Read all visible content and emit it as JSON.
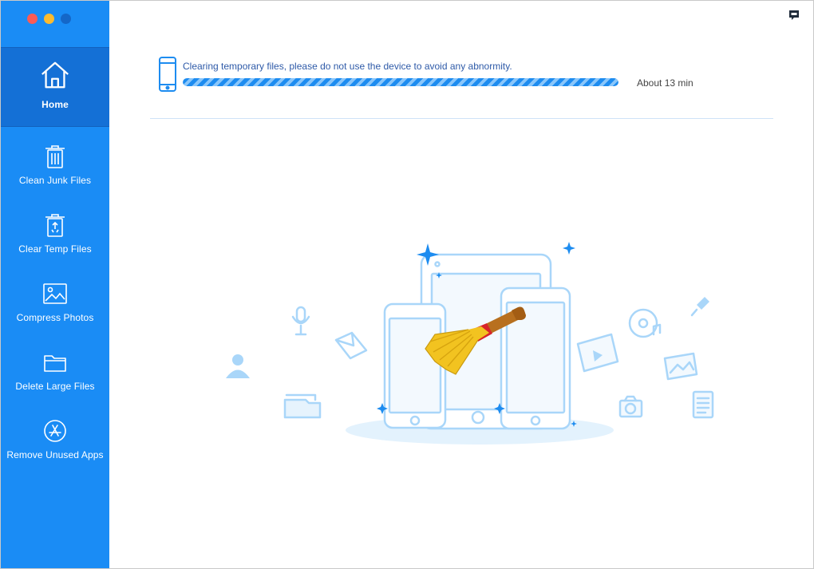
{
  "window": {
    "controls": [
      "close",
      "minimize",
      "zoom"
    ]
  },
  "sidebar": {
    "items": [
      {
        "label": "Home",
        "icon": "home-icon",
        "active": true
      },
      {
        "label": "Clean Junk Files",
        "icon": "trash-icon",
        "active": false
      },
      {
        "label": "Clear Temp Files",
        "icon": "temp-trash-icon",
        "active": false
      },
      {
        "label": "Compress Photos",
        "icon": "photo-icon",
        "active": false
      },
      {
        "label": "Delete Large Files",
        "icon": "folder-icon",
        "active": false
      },
      {
        "label": "Remove Unused Apps",
        "icon": "app-store-icon",
        "active": false
      }
    ]
  },
  "header": {
    "feedback_icon": "feedback-icon"
  },
  "progress": {
    "message": "Clearing temporary files, please do not use the device to avoid any abnormity.",
    "eta": "About 13 min",
    "percent": 100
  },
  "colors": {
    "sidebar": "#1a8cf5",
    "sidebar_active": "#1470d6",
    "accent": "#1d8cf0",
    "illustration": "#9fd0f7"
  }
}
